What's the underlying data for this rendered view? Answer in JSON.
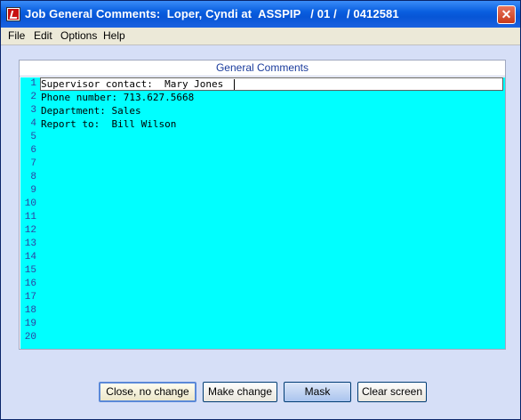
{
  "window": {
    "title": "Job General Comments:  Loper, Cyndi at  ASSPIP   / 01 /   / 0412581",
    "close_label": "✕"
  },
  "menu": {
    "items": [
      {
        "label": "File"
      },
      {
        "label": "Edit"
      },
      {
        "label": "Options"
      },
      {
        "label": "Help"
      }
    ]
  },
  "panel": {
    "title": "General Comments"
  },
  "editor": {
    "lines": [
      {
        "num": "1",
        "text": "Supervisor contact:  Mary Jones"
      },
      {
        "num": "2",
        "text": "Phone number: 713.627.5668"
      },
      {
        "num": "3",
        "text": "Department: Sales"
      },
      {
        "num": "4",
        "text": "Report to:  Bill Wilson"
      },
      {
        "num": "5",
        "text": ""
      },
      {
        "num": "6",
        "text": ""
      },
      {
        "num": "7",
        "text": ""
      },
      {
        "num": "8",
        "text": ""
      },
      {
        "num": "9",
        "text": ""
      },
      {
        "num": "10",
        "text": ""
      },
      {
        "num": "11",
        "text": ""
      },
      {
        "num": "12",
        "text": ""
      },
      {
        "num": "13",
        "text": ""
      },
      {
        "num": "14",
        "text": ""
      },
      {
        "num": "15",
        "text": ""
      },
      {
        "num": "16",
        "text": ""
      },
      {
        "num": "17",
        "text": ""
      },
      {
        "num": "18",
        "text": ""
      },
      {
        "num": "19",
        "text": ""
      },
      {
        "num": "20",
        "text": ""
      }
    ]
  },
  "buttons": {
    "close_no_change": "Close, no change",
    "make_change": "Make change",
    "mask": "Mask",
    "clear_screen": "Clear screen"
  },
  "colors": {
    "editor_bg": "#00ffff",
    "titlebar": "#0a5fe0",
    "window_bg": "#d6dff7"
  }
}
